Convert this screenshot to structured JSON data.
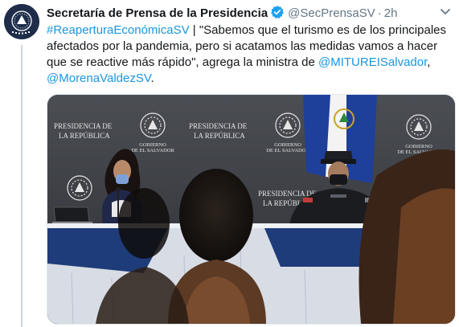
{
  "tweet": {
    "display_name": "Secretaría de Prensa de la Presidencia",
    "handle": "@SecPrensaSV",
    "separator": "·",
    "time": "2h",
    "hashtag": "#ReaperturaEconómicaSV",
    "text_part1": " | \"Sabemos que el turismo es de los principales afectados por la pandemia, pero si acatamos las medidas vamos a hacer que se reactive más rápido\", agrega la ministra de ",
    "mention1": "@MITUREISalvador",
    "text_part2": ",",
    "mention2": "@MorenaValdezSV",
    "text_part3": "."
  },
  "media": {
    "backdrop_label_line1": "PRESIDENCIA DE",
    "backdrop_label_line2": "LA REPÚBLICA",
    "seal_label_line1": "GOBIERNO",
    "seal_label_line2": "DE EL SALVADOR"
  },
  "icons": {
    "verified": "verified-badge-icon",
    "caret": "chevron-down-icon",
    "avatar": "government-seal-icon"
  },
  "colors": {
    "link": "#1b95e0",
    "verified": "#1da1f2",
    "text": "#14171a",
    "muted": "#657786"
  }
}
